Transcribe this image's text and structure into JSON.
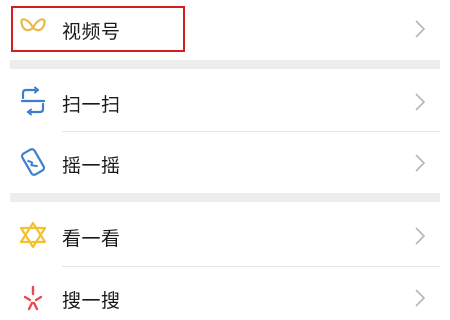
{
  "menu": {
    "channels": {
      "label": "视频号",
      "icon": "channels-butterfly-icon",
      "highlighted": true
    },
    "scan": {
      "label": "扫一扫",
      "icon": "scan-icon"
    },
    "shake": {
      "label": "摇一摇",
      "icon": "shake-icon"
    },
    "top_stories": {
      "label": "看一看",
      "icon": "top-stories-icon"
    },
    "search": {
      "label": "搜一搜",
      "icon": "search-sparkle-icon"
    }
  },
  "colors": {
    "channels_icon": "#e8b84a",
    "scan_icon": "#3d7fcf",
    "shake_icon": "#3d7fcf",
    "top_stories_icon": "#f2c230",
    "search_icon": "#e94b4b",
    "highlight_border": "#d22020",
    "section_gap": "#ededed",
    "chevron": "#b5b5b5"
  }
}
